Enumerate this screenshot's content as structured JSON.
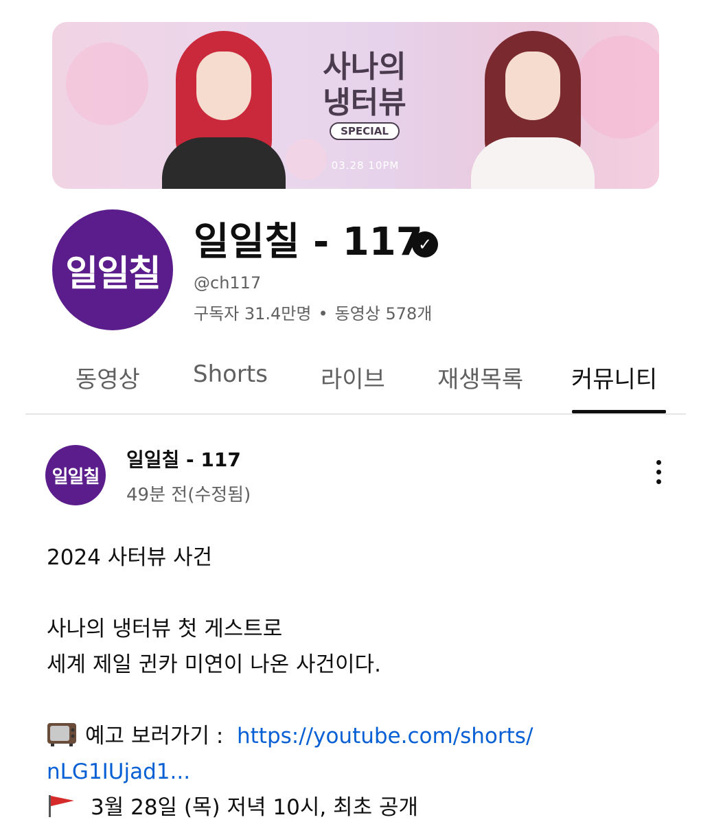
{
  "banner": {
    "logo_line1": "사나의",
    "logo_line2": "냉터뷰",
    "logo_badge": "SPECIAL",
    "date": "03.28 10PM"
  },
  "channel": {
    "avatar_text": "일일칠",
    "name": "일일칠 - 117",
    "handle": "@ch117",
    "subscribers": "구독자 31.4만명",
    "separator": "•",
    "videos": "동영상 578개"
  },
  "tabs": [
    {
      "label": "동영상",
      "active": false
    },
    {
      "label": "Shorts",
      "active": false
    },
    {
      "label": "라이브",
      "active": false
    },
    {
      "label": "재생목록",
      "active": false
    },
    {
      "label": "커뮤니티",
      "active": true
    }
  ],
  "post": {
    "avatar_text": "일일칠",
    "author": "일일칠 - 117",
    "time": "49분 전(수정됨)",
    "lines": {
      "l1": "2024 사터뷰 사건",
      "l2": "사나의 냉터뷰 첫 게스트로",
      "l3": "세계 제일 귄카 미연이 나온 사건이다.",
      "l4_prefix": "예고 보러가기 :",
      "l4_link": "https://youtube.com/shorts/",
      "l5_link": "nLG1IUjad1...",
      "l6": "3월 28일 (목) 저녁 10시, 최초 공개"
    },
    "icons": {
      "tv": "tv-icon",
      "flag": "red-flag-icon",
      "more": "more-vertical-icon",
      "verified": "verified-check-icon"
    }
  },
  "colors": {
    "brand_purple": "#5b1d8c",
    "link_blue": "#065fd4",
    "secondary_text": "#606060"
  }
}
